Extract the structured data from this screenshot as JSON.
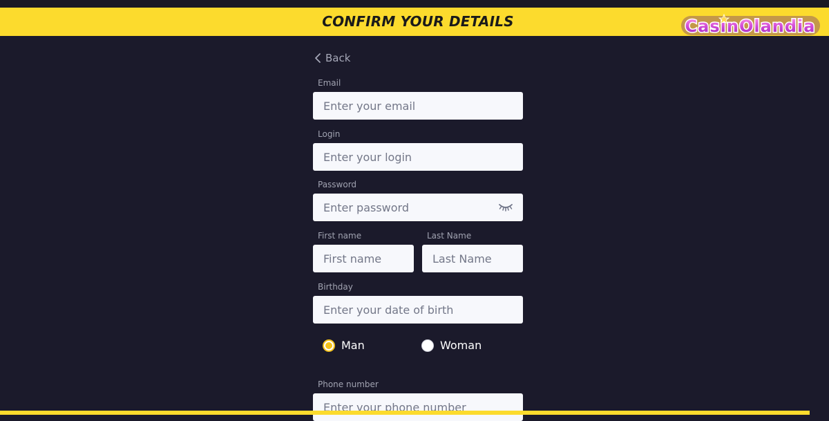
{
  "header": {
    "title": "CONFIRM YOUR DETAILS",
    "logo_text": "CasinOlandia"
  },
  "back": {
    "label": "Back"
  },
  "fields": {
    "email": {
      "label": "Email",
      "placeholder": "Enter your email",
      "value": ""
    },
    "login": {
      "label": "Login",
      "placeholder": "Enter your login",
      "value": ""
    },
    "password": {
      "label": "Password",
      "placeholder": "Enter password",
      "value": ""
    },
    "first_name": {
      "label": "First name",
      "placeholder": "First name",
      "value": ""
    },
    "last_name": {
      "label": "Last Name",
      "placeholder": "Last Name",
      "value": ""
    },
    "birthday": {
      "label": "Birthday",
      "placeholder": "Enter your date of birth",
      "value": ""
    },
    "phone": {
      "label": "Phone number",
      "placeholder": "Enter your phone number",
      "value": ""
    }
  },
  "gender": {
    "options": [
      {
        "label": "Man",
        "checked": true
      },
      {
        "label": "Woman",
        "checked": false
      }
    ]
  },
  "colors": {
    "accent": "#fcdb2d",
    "background": "#1b1a2b",
    "field_bg": "#f7f8fc",
    "radio_checked": "#f4c21b"
  },
  "icons": {
    "back": "chevron-left-icon",
    "password_toggle": "eye-closed-icon",
    "logo": "casinolandia-logo"
  }
}
